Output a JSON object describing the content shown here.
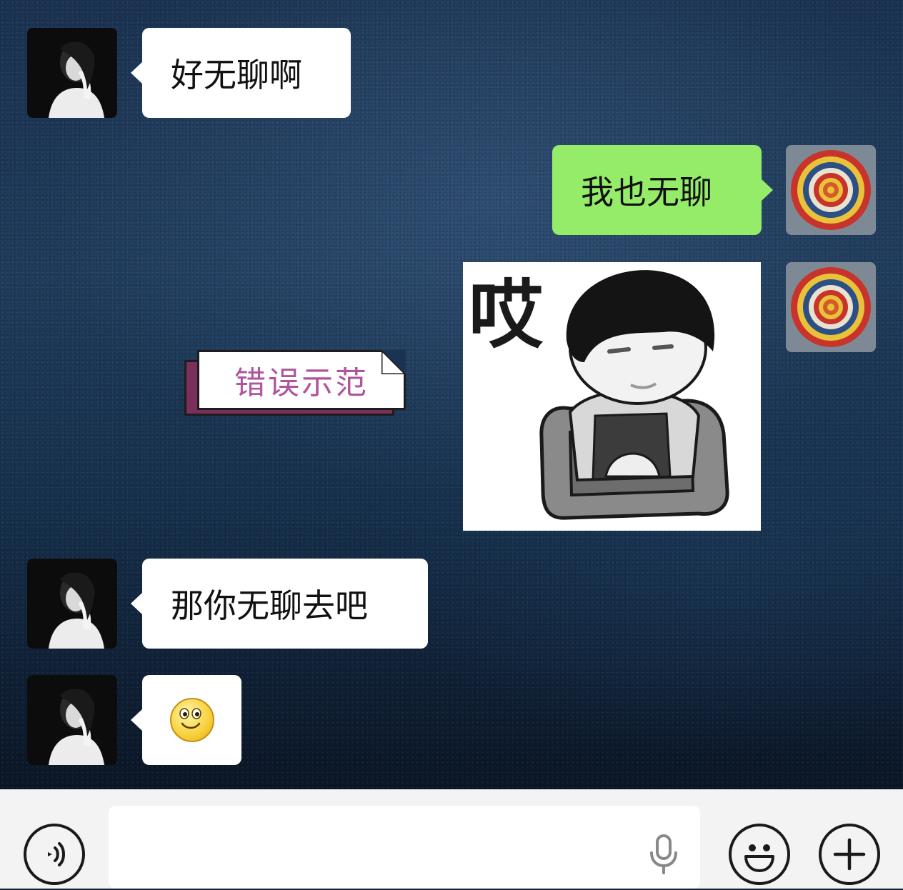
{
  "messages": [
    {
      "side": "left",
      "type": "text",
      "text": "好无聊啊"
    },
    {
      "side": "right",
      "type": "text",
      "text": "我也无聊"
    },
    {
      "side": "right",
      "type": "sticker",
      "caption": "哎"
    },
    {
      "side": "left",
      "type": "text",
      "text": "那你无聊去吧"
    },
    {
      "side": "left",
      "type": "emoji",
      "emoji_name": "smile-emoji"
    }
  ],
  "overlay_label": "错误示范",
  "input_bar": {
    "voice_icon": "voice-icon",
    "mic_icon": "microphone-icon",
    "emoji_icon": "emoji-face-icon",
    "plus_icon": "plus-icon",
    "placeholder": ""
  },
  "colors": {
    "sent_bubble": "#95ec69",
    "received_bubble": "#ffffff",
    "label_text": "#b0549c",
    "label_shadow": "#7a2f5c"
  }
}
